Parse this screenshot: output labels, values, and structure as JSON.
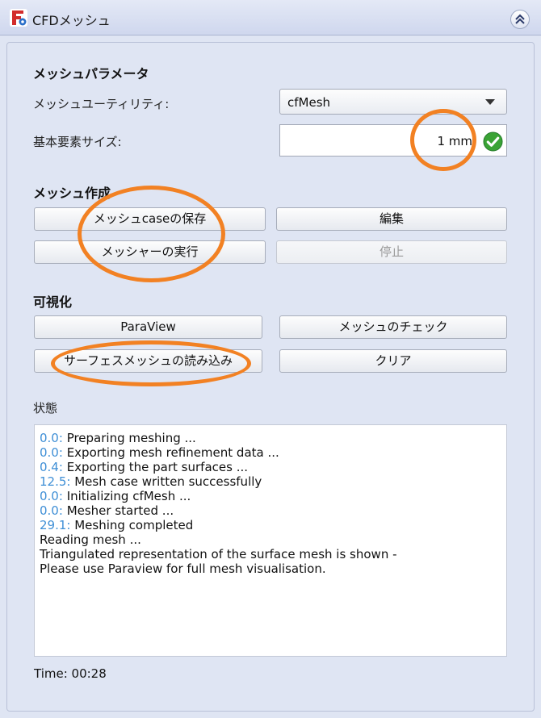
{
  "window": {
    "title": "CFDメッシュ"
  },
  "mesh_params": {
    "heading": "メッシュパラメータ",
    "utility_label": "メッシュユーティリティ:",
    "utility_value": "cfMesh",
    "base_size_label": "基本要素サイズ:",
    "base_size_value": "1 mm"
  },
  "mesh_creation": {
    "heading": "メッシュ作成",
    "save_case": "メッシュcaseの保存",
    "edit": "編集",
    "run_mesher": "メッシャーの実行",
    "stop": "停止"
  },
  "visualization": {
    "heading": "可視化",
    "paraview": "ParaView",
    "check_mesh": "メッシュのチェック",
    "load_surface": "サーフェスメッシュの読み込み",
    "clear": "クリア"
  },
  "status": {
    "heading": "状態",
    "log": [
      {
        "time": "0.0:",
        "text": " Preparing meshing ..."
      },
      {
        "time": "0.0:",
        "text": " Exporting mesh refinement data ..."
      },
      {
        "time": "0.4:",
        "text": " Exporting the part surfaces ..."
      },
      {
        "time": "12.5:",
        "text": " Mesh case written successfully"
      },
      {
        "time": "0.0:",
        "text": " Initializing cfMesh ..."
      },
      {
        "time": "0.0:",
        "text": " Mesher started ..."
      },
      {
        "time": "29.1:",
        "text": " Meshing completed"
      },
      {
        "time": "",
        "text": "Reading mesh ..."
      },
      {
        "time": "",
        "text": "Triangulated representation of the surface mesh is shown -"
      },
      {
        "time": "",
        "text": "Please use Paraview for full mesh visualisation."
      }
    ]
  },
  "footer": {
    "time": "Time: 00:28"
  },
  "colors": {
    "background": "#dfe5f3",
    "log_timestamp": "#3f8fd6",
    "highlight": "#f28123",
    "valid_check": "#3aa335"
  }
}
